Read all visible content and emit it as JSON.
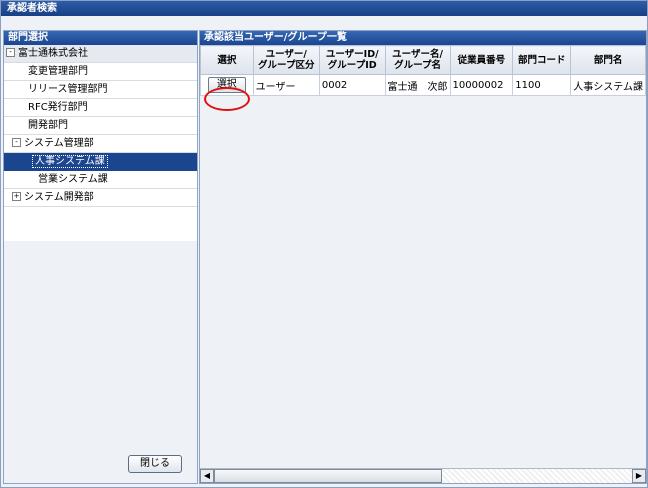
{
  "window": {
    "title": "承認者検索"
  },
  "left_pane": {
    "header": "部門選択",
    "tree": [
      {
        "label": "富士通株式会社",
        "toggle": "-",
        "level": "root",
        "selected": false
      },
      {
        "label": "変更管理部門",
        "level": "lvl1",
        "selected": false
      },
      {
        "label": "リリース管理部門",
        "level": "lvl1",
        "selected": false
      },
      {
        "label": "RFC発行部門",
        "level": "lvl1",
        "selected": false
      },
      {
        "label": "開発部門",
        "level": "lvl1",
        "selected": false
      },
      {
        "label": "システム管理部",
        "toggle": "-",
        "level": "lvl2",
        "selected": false
      },
      {
        "label": "人事システム課",
        "level": "lvl3x",
        "selected": true
      },
      {
        "label": "営業システム課",
        "level": "lvl3",
        "selected": false
      },
      {
        "label": "システム開発部",
        "toggle": "+",
        "level": "lvl2",
        "selected": false
      }
    ],
    "close_label": "閉じる"
  },
  "right_pane": {
    "header": "承認該当ユーザー/グループ一覧",
    "columns": [
      {
        "line1": "選択",
        "line2": ""
      },
      {
        "line1": "ユーザー/",
        "line2": "グループ区分"
      },
      {
        "line1": "ユーザーID/",
        "line2": "グループID"
      },
      {
        "line1": "ユーザー名/",
        "line2": "グループ名"
      },
      {
        "line1": "従業員番号",
        "line2": ""
      },
      {
        "line1": "部門コード",
        "line2": ""
      },
      {
        "line1": "部門名",
        "line2": ""
      }
    ],
    "rows": [
      {
        "select_label": "選択",
        "type": "ユーザー",
        "id": "0002",
        "name": "富士通　次郎",
        "employee_no": "10000002",
        "dept_code": "1100",
        "dept_name": "人事システム課"
      }
    ]
  },
  "colors": {
    "header_blue": "#1c4590",
    "selected_bg": "#1c4590",
    "callout_red": "#e01010"
  }
}
